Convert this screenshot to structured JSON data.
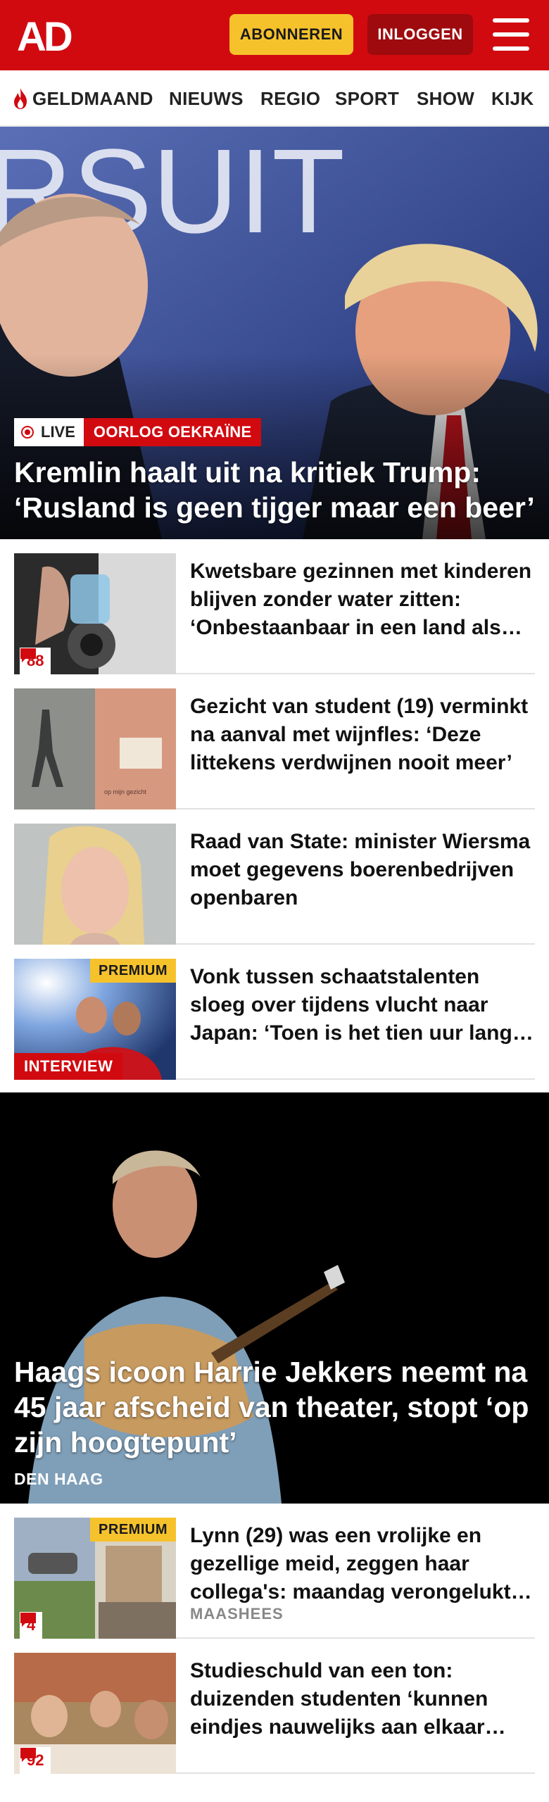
{
  "header": {
    "logo_text": "AD",
    "subscribe_label": "ABONNEREN",
    "login_label": "INLOGGEN",
    "menu_icon": "hamburger-icon",
    "brand_color": "#d10a10",
    "accent_color": "#f6c22c"
  },
  "nav": {
    "items": [
      {
        "label": "GELDMAAND",
        "icon": "flame-icon"
      },
      {
        "label": "NIEUWS"
      },
      {
        "label": "REGIO"
      },
      {
        "label": "SPORT"
      },
      {
        "label": "SHOW"
      },
      {
        "label": "KIJK"
      }
    ]
  },
  "hero": {
    "live_label": "LIVE",
    "category": "OORLOG OEKRAÏNE",
    "title": "Kremlin haalt uit na kritiek Trump: ‘Rusland is geen tijger maar een beer’"
  },
  "articles": [
    {
      "title": "Kwetsbare gezinnen met kinderen blijven zonder water zitten: ‘Onbestaanbaar in een land als Nederland’",
      "comments": "88"
    },
    {
      "title": "Gezicht van student (19) verminkt na aanval met wijnfles: ‘Deze littekens verdwijnen nooit meer’"
    },
    {
      "title": "Raad van State: minister Wiersma moet gegevens boerenbedrijven openbaren"
    },
    {
      "title": "Vonk tussen schaatstalenten sloeg over tijdens vlucht naar Japan: ‘Toen is het tien uur lang gaan knallen’",
      "badge": "PREMIUM",
      "label": "INTERVIEW"
    }
  ],
  "feature": {
    "title": "Haags icoon Harrie Jekkers neemt na 45 jaar afscheid van theater, stopt ‘op zijn hoogtepunt’",
    "location": "DEN HAAG"
  },
  "articles2": [
    {
      "title": "Lynn (29) was een vrolijke en gezellige meid, zeggen haar collega's: maandag verongelukte ze",
      "badge": "PREMIUM",
      "comments": "4",
      "location": "MAASHEES"
    },
    {
      "title": "Studieschuld van een ton: duizenden studenten ‘kunnen eindjes nauwelijks aan elkaar knopen’",
      "comments": "92"
    }
  ]
}
